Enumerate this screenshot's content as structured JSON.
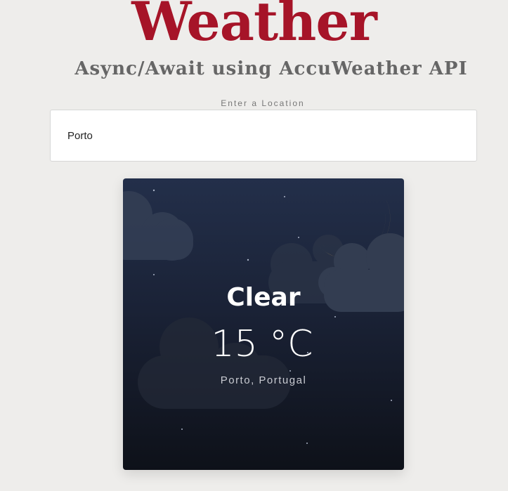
{
  "header": {
    "title": "Weather",
    "subtitle": "Async/Await using AccuWeather API"
  },
  "search": {
    "label": "Enter a Location",
    "value": "Porto"
  },
  "weather_card": {
    "condition": "Clear",
    "temperature": "15 °C",
    "location": "Porto, Portugal",
    "icon": "moon-icon",
    "colors": {
      "sky_top": "#232f4a",
      "sky_bottom": "#0e1119",
      "moon": "#f8dc7e"
    }
  }
}
